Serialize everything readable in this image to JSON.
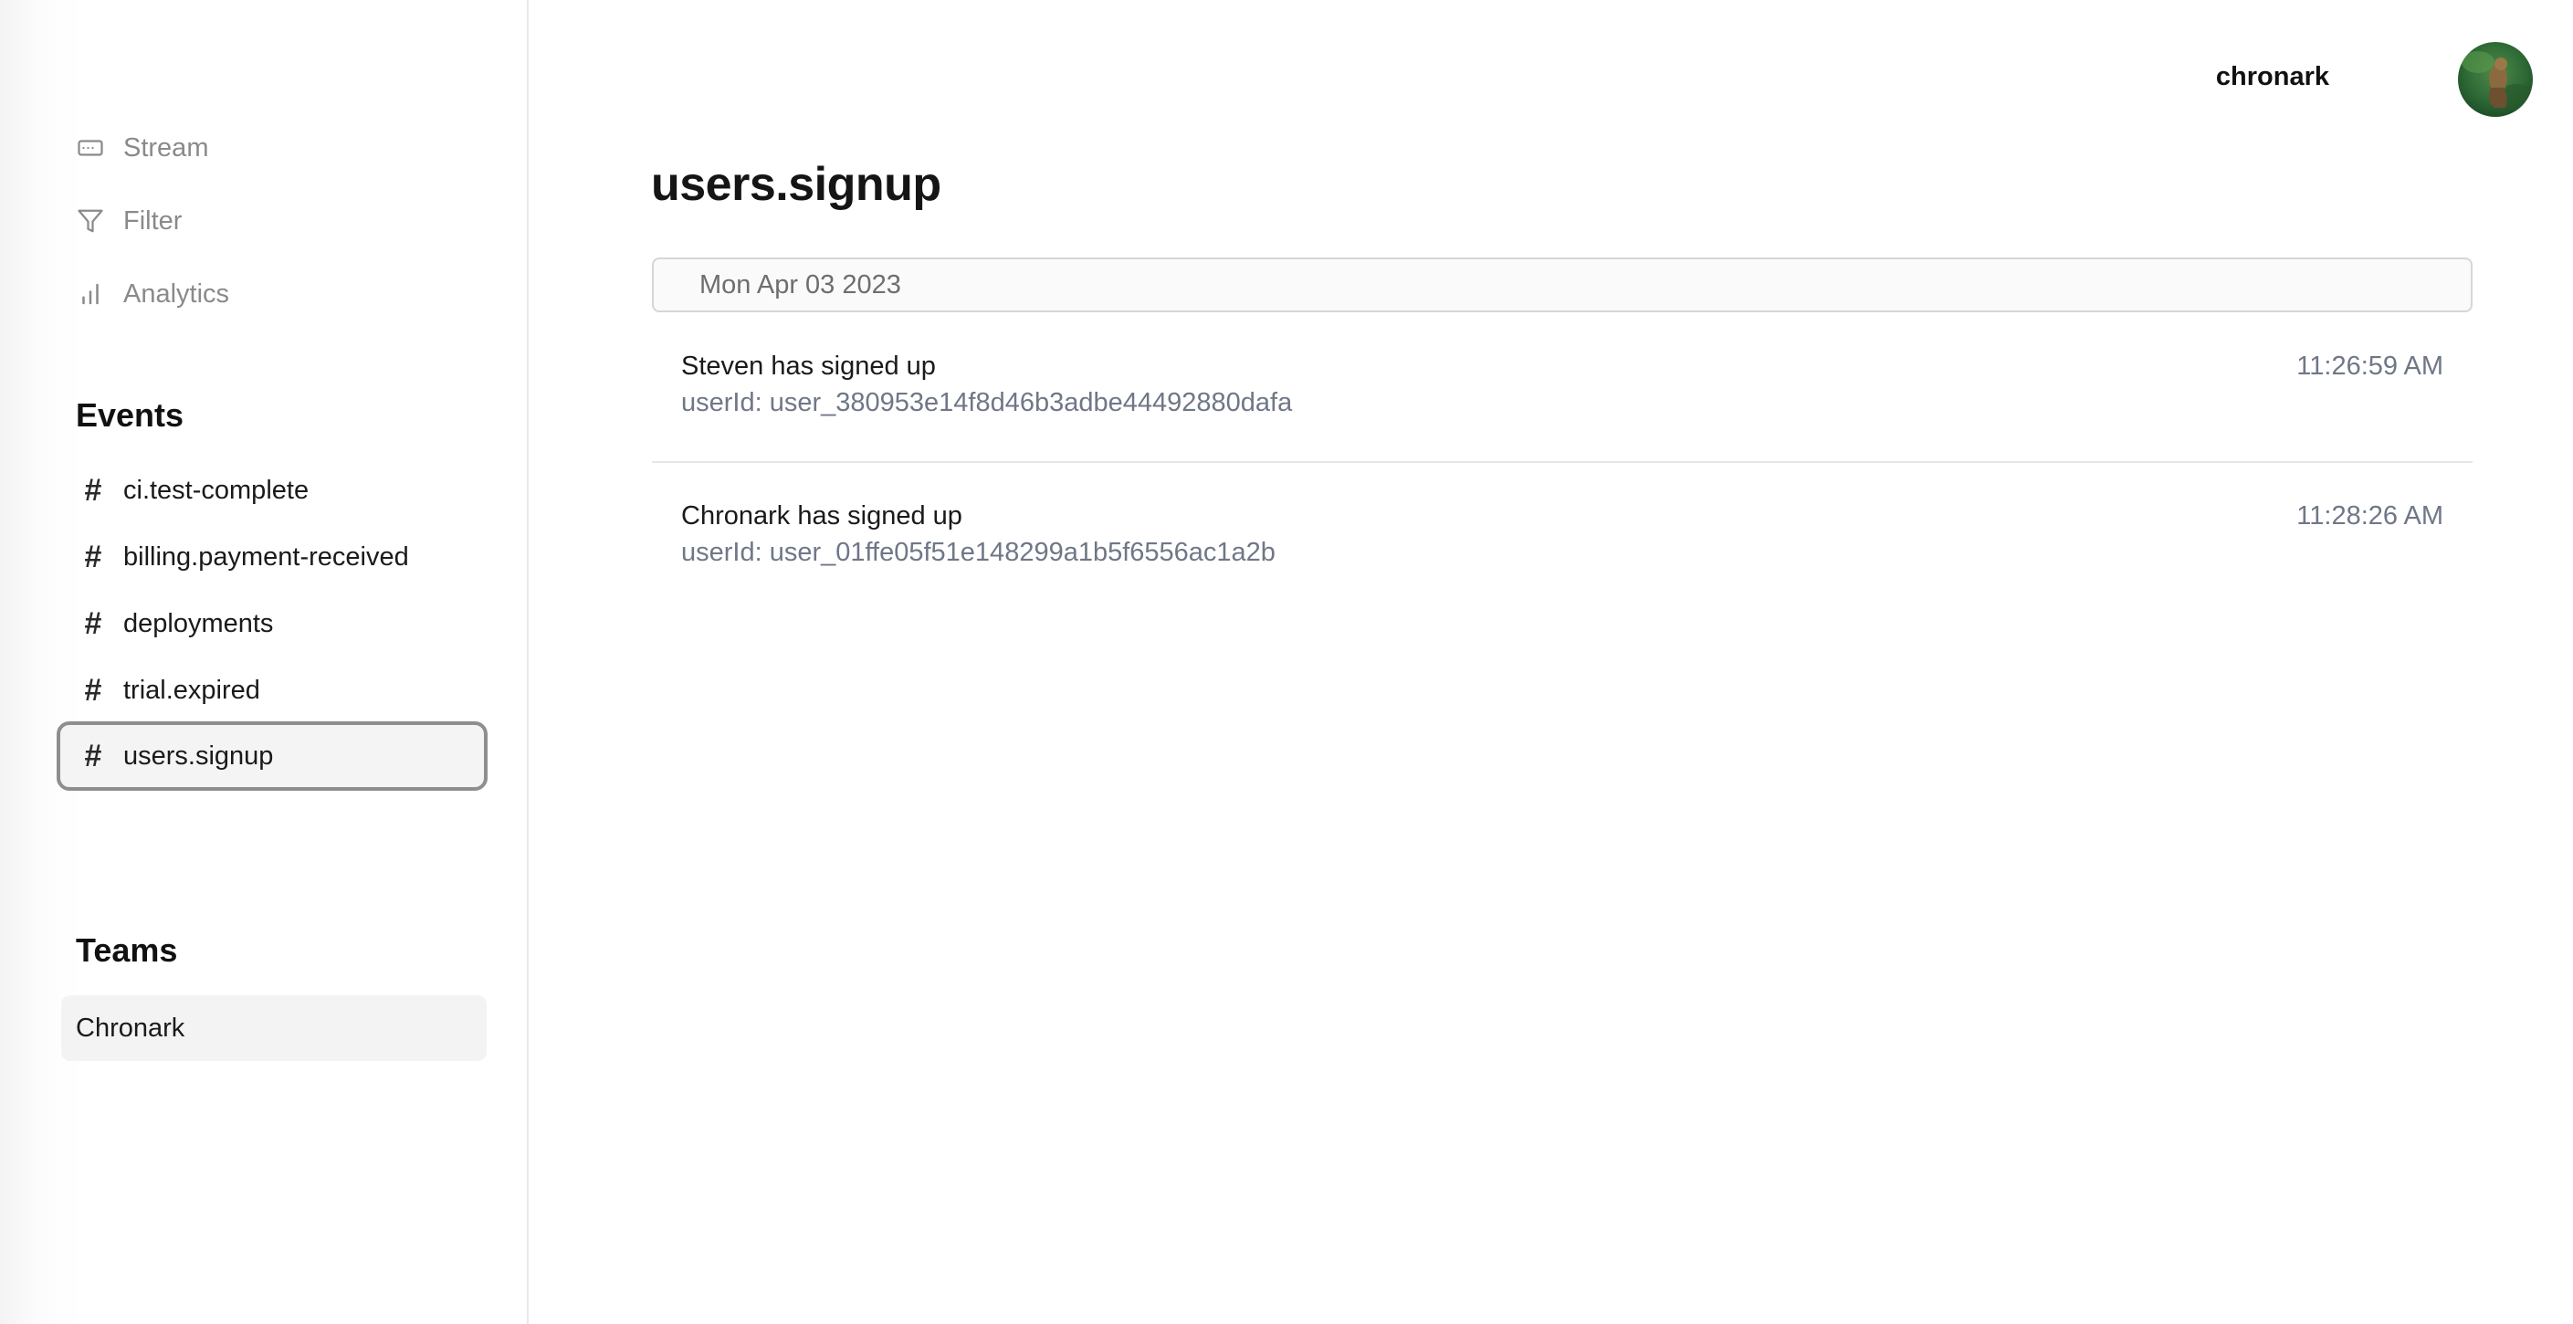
{
  "sidebar": {
    "nav": [
      {
        "label": "Stream",
        "icon": "stream-icon"
      },
      {
        "label": "Filter",
        "icon": "filter-icon"
      },
      {
        "label": "Analytics",
        "icon": "analytics-icon"
      }
    ],
    "events_title": "Events",
    "events": [
      {
        "label": "ci.test-complete"
      },
      {
        "label": "billing.payment-received"
      },
      {
        "label": "deployments"
      },
      {
        "label": "trial.expired"
      },
      {
        "label": "users.signup",
        "active": true
      }
    ],
    "teams_title": "Teams",
    "teams": [
      {
        "label": "Chronark"
      }
    ]
  },
  "header": {
    "username": "chronark",
    "avatar_icon": "user-avatar"
  },
  "main": {
    "title": "users.signup",
    "date": "Mon Apr 03 2023",
    "events": [
      {
        "title": "Steven has signed up",
        "subtitle": "userId: user_380953e14f8d46b3adbe44492880dafa",
        "time": "11:26:59 AM"
      },
      {
        "title": "Chronark has signed up",
        "subtitle": "userId: user_01ffe05f51e148299a1b5f6556ac1a2b",
        "time": "11:28:26 AM"
      }
    ]
  },
  "colors": {
    "active_border": "#8e8e8e",
    "muted_text": "#6f7787",
    "nav_text": "#8a8a8a"
  }
}
